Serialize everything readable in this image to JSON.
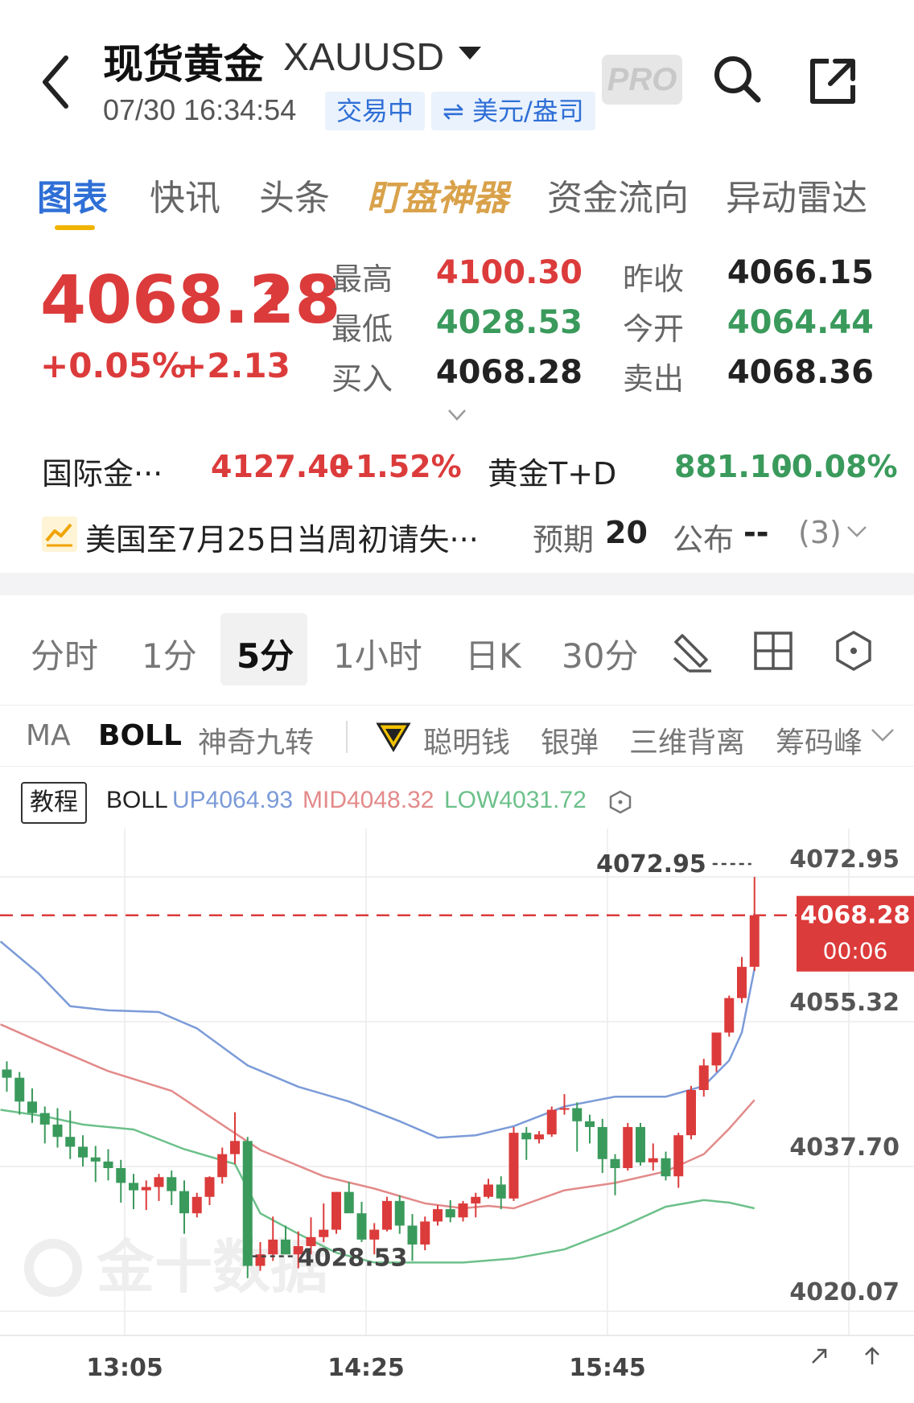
{
  "header": {
    "title": "现货黄金",
    "symbol": "XAUUSD",
    "time": "07/30 16:34:54",
    "status_badge": "交易中",
    "unit_badge": "⇌ 美元/盎司",
    "pro_label": "PRO"
  },
  "tabs": [
    {
      "label": "图表",
      "active": true
    },
    {
      "label": "快讯"
    },
    {
      "label": "头条"
    },
    {
      "label": "盯盘神器",
      "special": true
    },
    {
      "label": "资金流向"
    },
    {
      "label": "异动雷达"
    }
  ],
  "quote": {
    "price": "4068.28",
    "change_pct": "+0.05%",
    "change": "+2.13",
    "high_label": "最高",
    "high": "4100.30",
    "low_label": "最低",
    "low": "4028.53",
    "bid_label": "买入",
    "bid": "4068.28",
    "prev_close_label": "昨收",
    "prev_close": "4066.15",
    "open_label": "今开",
    "open": "4064.44",
    "ask_label": "卖出",
    "ask": "4068.36"
  },
  "related": {
    "intl_gold_label": "国际金···",
    "intl_gold_price": "4127.40",
    "intl_gold_pct": "+1.52%",
    "td_label": "黄金T+D",
    "td_price": "881.10",
    "td_pct": "-0.08%"
  },
  "event": {
    "text": "美国至7月25日当周初请失···",
    "expect_label": "预期",
    "expect": "20",
    "publish_label": "公布",
    "publish": "--",
    "count": "(3)"
  },
  "periods": [
    {
      "label": "分时"
    },
    {
      "label": "1分"
    },
    {
      "label": "5分",
      "active": true
    },
    {
      "label": "1小时"
    },
    {
      "label": "日K"
    },
    {
      "label": "30分"
    }
  ],
  "indicators": {
    "ma": "MA",
    "boll": "BOLL",
    "nine": "神奇九转",
    "smart_money": "聪明钱",
    "silver_bullet": "银弹",
    "divergence": "三维背离",
    "chips": "筹码峰"
  },
  "boll_info": {
    "tutorial": "教程",
    "name": "BOLL",
    "up": "UP4064.93",
    "mid": "MID4048.32",
    "low": "LOW4031.72"
  },
  "colors": {
    "up": "#dc3b3b",
    "down": "#3a9a5c",
    "accent": "#2f6fd6",
    "boll_up": "#7b9bd8",
    "boll_mid": "#e38a8a",
    "boll_low": "#6cc08a"
  },
  "chart_data": {
    "type": "candlestick",
    "y_ticks": [
      "4072.95",
      "4055.32",
      "4037.70",
      "4020.07"
    ],
    "y_range": [
      4020.07,
      4072.95
    ],
    "x_ticks": [
      "13:05",
      "14:25",
      "15:45"
    ],
    "last_price_label": "4068.28",
    "last_price": 4068.28,
    "countdown": "00:06",
    "max_label": "4072.95",
    "max_value": 4072.95,
    "min_label": "4028.53",
    "min_value": 4028.53,
    "watermark": "金十数据",
    "candles": [
      [
        4049.5,
        4050.5,
        4046.8,
        4048.5
      ],
      [
        4048.5,
        4049.2,
        4044.0,
        4045.6
      ],
      [
        4045.6,
        4047.2,
        4043.0,
        4044.2
      ],
      [
        4044.2,
        4045.0,
        4040.5,
        4042.8
      ],
      [
        4042.8,
        4044.8,
        4040.0,
        4041.3
      ],
      [
        4041.3,
        4044.5,
        4038.6,
        4040.1
      ],
      [
        4040.1,
        4041.5,
        4037.7,
        4038.8
      ],
      [
        4038.8,
        4040.2,
        4035.8,
        4038.3
      ],
      [
        4038.3,
        4039.8,
        4036.0,
        4037.5
      ],
      [
        4037.5,
        4038.5,
        4033.3,
        4035.7
      ],
      [
        4035.7,
        4036.8,
        4032.5,
        4034.8
      ],
      [
        4034.8,
        4036.0,
        4032.4,
        4035.2
      ],
      [
        4035.2,
        4036.8,
        4033.5,
        4036.4
      ],
      [
        4036.4,
        4037.2,
        4033.0,
        4034.7
      ],
      [
        4034.7,
        4036.0,
        4029.5,
        4032.0
      ],
      [
        4032.0,
        4034.5,
        4031.5,
        4034.0
      ],
      [
        4034.0,
        4036.5,
        4033.0,
        4036.4
      ],
      [
        4036.4,
        4040.0,
        4035.6,
        4039.2
      ],
      [
        4039.2,
        4044.3,
        4038.0,
        4040.8
      ],
      [
        4040.8,
        4041.3,
        4024.1,
        4025.6
      ],
      [
        4025.6,
        4028.5,
        4025.0,
        4027.0
      ],
      [
        4027.0,
        4031.6,
        4026.2,
        4028.8
      ],
      [
        4028.8,
        4030.5,
        4027.5,
        4027.0
      ],
      [
        4027.0,
        4029.8,
        4025.3,
        4028.0
      ],
      [
        4028.0,
        4031.5,
        4027.0,
        4029.1
      ],
      [
        4029.1,
        4033.2,
        4028.5,
        4030.0
      ],
      [
        4030.0,
        4034.6,
        4029.5,
        4034.6
      ],
      [
        4034.6,
        4035.8,
        4032.5,
        4032.0
      ],
      [
        4032.0,
        4033.4,
        4028.5,
        4028.8
      ],
      [
        4028.8,
        4030.8,
        4027.0,
        4030.0
      ],
      [
        4030.0,
        4034.0,
        4029.8,
        4033.5
      ],
      [
        4033.5,
        4034.2,
        4029.5,
        4030.5
      ],
      [
        4030.5,
        4031.9,
        4026.2,
        4028.2
      ],
      [
        4028.2,
        4031.6,
        4027.5,
        4031.0
      ],
      [
        4031.0,
        4033.0,
        4030.5,
        4032.5
      ],
      [
        4032.5,
        4033.6,
        4030.9,
        4031.5
      ],
      [
        4031.5,
        4033.5,
        4031.0,
        4033.2
      ],
      [
        4033.2,
        4034.5,
        4031.5,
        4034.0
      ],
      [
        4034.0,
        4036.2,
        4033.8,
        4035.5
      ],
      [
        4035.5,
        4036.5,
        4032.5,
        4033.8
      ],
      [
        4033.8,
        4042.5,
        4033.5,
        4041.8
      ],
      [
        4041.8,
        4042.5,
        4038.5,
        4041.0
      ],
      [
        4041.0,
        4042.0,
        4040.5,
        4041.6
      ],
      [
        4041.6,
        4045.0,
        4041.3,
        4044.6
      ],
      [
        4044.6,
        4046.5,
        4044.0,
        4044.8
      ],
      [
        4044.8,
        4045.5,
        4039.5,
        4043.2
      ],
      [
        4043.2,
        4044.0,
        4040.5,
        4042.5
      ],
      [
        4042.5,
        4043.5,
        4036.9,
        4038.6
      ],
      [
        4038.6,
        4039.2,
        4034.2,
        4037.5
      ],
      [
        4037.5,
        4043.0,
        4037.2,
        4042.5
      ],
      [
        4042.5,
        4043.0,
        4037.8,
        4038.2
      ],
      [
        4038.2,
        4040.5,
        4037.2,
        4038.7
      ],
      [
        4038.7,
        4039.5,
        4036.0,
        4036.5
      ],
      [
        4036.5,
        4041.8,
        4035.1,
        4041.5
      ],
      [
        4041.5,
        4047.5,
        4041.0,
        4047.0
      ],
      [
        4047.0,
        4050.8,
        4046.2,
        4050.0
      ],
      [
        4050.0,
        4054.0,
        4049.2,
        4054.0
      ],
      [
        4054.0,
        4058.5,
        4053.5,
        4058.2
      ],
      [
        4058.2,
        4063.2,
        4057.6,
        4062.0
      ],
      [
        4062.0,
        4072.95,
        4061.5,
        4068.28
      ]
    ],
    "boll_up_pts": [
      [
        -0.5,
        4065.1
      ],
      [
        2.5,
        4061.2
      ],
      [
        5,
        4057.2
      ],
      [
        8,
        4056.7
      ],
      [
        12,
        4056.5
      ],
      [
        15,
        4054.5
      ],
      [
        19,
        4050.0
      ],
      [
        23,
        4047.4
      ],
      [
        27,
        4045.6
      ],
      [
        31,
        4043.2
      ],
      [
        34,
        4041.2
      ],
      [
        37,
        4041.5
      ],
      [
        40,
        4042.6
      ],
      [
        44,
        4045.0
      ],
      [
        48,
        4046.2
      ],
      [
        52,
        4046.2
      ],
      [
        55,
        4047.5
      ],
      [
        57,
        4050.6
      ],
      [
        58,
        4054.0
      ],
      [
        59,
        4061.8
      ]
    ],
    "boll_mid_pts": [
      [
        -0.5,
        4055.0
      ],
      [
        3,
        4052.6
      ],
      [
        8,
        4049.3
      ],
      [
        13,
        4046.9
      ],
      [
        16,
        4043.8
      ],
      [
        20,
        4039.7
      ],
      [
        25,
        4036.5
      ],
      [
        29,
        4035.0
      ],
      [
        33,
        4033.2
      ],
      [
        36,
        4032.6
      ],
      [
        38,
        4032.9
      ],
      [
        40,
        4032.6
      ],
      [
        44,
        4034.8
      ],
      [
        48,
        4035.7
      ],
      [
        52,
        4037.1
      ],
      [
        55,
        4039.2
      ],
      [
        57,
        4042.3
      ],
      [
        59,
        4045.8
      ]
    ],
    "boll_low_pts": [
      [
        -0.5,
        4044.6
      ],
      [
        3,
        4043.8
      ],
      [
        6,
        4042.8
      ],
      [
        10,
        4042.2
      ],
      [
        14,
        4039.8
      ],
      [
        18,
        4038.0
      ],
      [
        20,
        4032.0
      ],
      [
        23,
        4029.5
      ],
      [
        26,
        4027.2
      ],
      [
        29,
        4026.0
      ],
      [
        33,
        4026.0
      ],
      [
        36,
        4026.0
      ],
      [
        40,
        4026.5
      ],
      [
        44,
        4027.6
      ],
      [
        48,
        4030.0
      ],
      [
        52,
        4032.8
      ],
      [
        55,
        4033.6
      ],
      [
        57,
        4033.3
      ],
      [
        59,
        4032.6
      ]
    ]
  }
}
